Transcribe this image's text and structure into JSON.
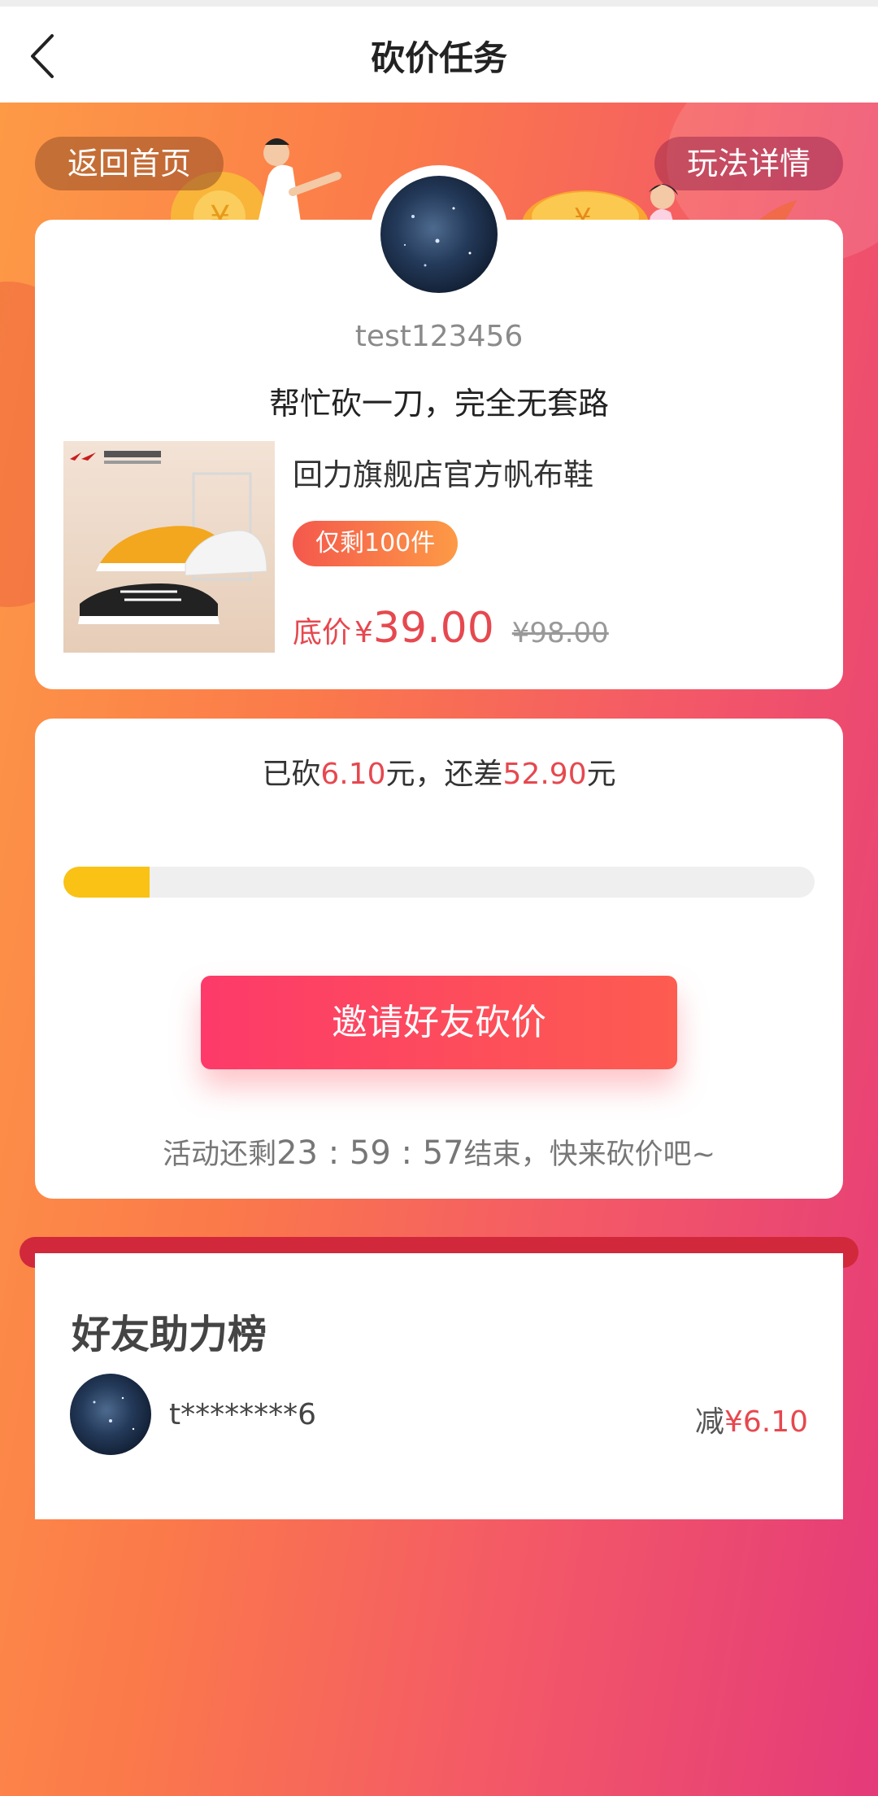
{
  "nav": {
    "title": "砍价任务"
  },
  "header": {
    "home_label": "返回首页",
    "rules_label": "玩法详情"
  },
  "user": {
    "name": "test123456"
  },
  "slogan": "帮忙砍一刀，完全无套路",
  "product": {
    "name": "回力旗舰店官方帆布鞋",
    "stock": "仅剩100件",
    "price_label": "底价",
    "currency": "¥",
    "price": "39.00",
    "original_price": "¥98.00"
  },
  "bargain": {
    "cut_prefix": "已砍",
    "cut_amount": "6.10",
    "cut_mid": "元，还差",
    "remaining": "52.90",
    "cut_suffix": "元",
    "progress_fraction": 0.115,
    "invite_label": "邀请好友砍价",
    "countdown_prefix": "活动还剩",
    "countdown_time": "23 : 59 : 57",
    "countdown_suffix": "结束，快来砍价吧~"
  },
  "leaderboard": {
    "title": "好友助力榜",
    "entries": [
      {
        "name": "t********6",
        "cut_label": "减",
        "amount": "¥6.10"
      }
    ]
  },
  "colors": {
    "accent_red": "#e6484f",
    "progress": "#f9c214",
    "button": "#fd3a6a"
  }
}
